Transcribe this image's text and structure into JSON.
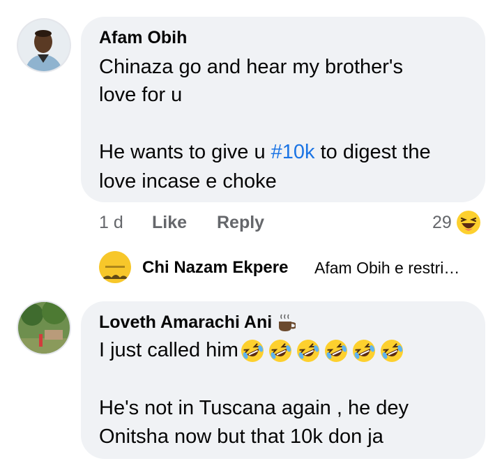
{
  "comments": [
    {
      "author": "Afam Obih",
      "text_line1": "Chinaza go and hear my brother's",
      "text_line2": "love for u",
      "text_line3_pre": "He wants to give u ",
      "text_line3_tag": "#10k",
      "text_line3_post": " to digest the",
      "text_line4": "love incase e choke",
      "time": "1 d",
      "like_label": "Like",
      "reply_label": "Reply",
      "reaction_count": "29",
      "reaction_icon": "haha-emoji-icon",
      "reply_preview": {
        "author": "Chi Nazam Ekpere",
        "snippet": "Afam Obih e restri…"
      }
    },
    {
      "author": "Loveth Amarachi Ani",
      "author_badge": "hot-beverage-icon",
      "text_line1": "I just called him",
      "emoji_count": 6,
      "emoji_icon": "rolling-laughing-emoji-icon",
      "text_line3": "He's not in Tuscana again , he dey",
      "text_line4": "Onitsha now but that 10k don ja"
    }
  ],
  "colors": {
    "bubble": "#f0f2f5",
    "meta_text": "#65676b",
    "hashtag": "#1b74e4",
    "emoji_yellow": "#fdd02e"
  }
}
